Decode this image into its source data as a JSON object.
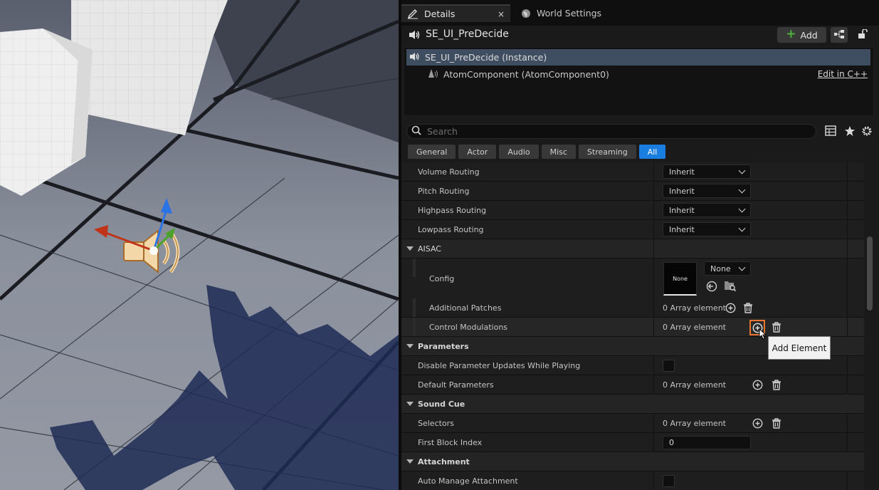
{
  "tabs": {
    "details": "Details",
    "world_settings": "World Settings",
    "close": "×"
  },
  "object": {
    "name": "SE_UI_PreDecide",
    "add_label": "Add"
  },
  "components": {
    "instance": "SE_UI_PreDecide (Instance)",
    "child": "AtomComponent (AtomComponent0)",
    "edit_link": "Edit in C++"
  },
  "search": {
    "placeholder": "Search"
  },
  "filters": [
    "General",
    "Actor",
    "Audio",
    "Misc",
    "Streaming",
    "All"
  ],
  "active_filter": "All",
  "properties": {
    "volume_routing": {
      "label": "Volume Routing",
      "value": "Inherit"
    },
    "pitch_routing": {
      "label": "Pitch Routing",
      "value": "Inherit"
    },
    "highpass_routing": {
      "label": "Highpass Routing",
      "value": "Inherit"
    },
    "lowpass_routing": {
      "label": "Lowpass Routing",
      "value": "Inherit"
    },
    "aisac": "AISAC",
    "config": {
      "label": "Config",
      "thumb": "None",
      "value": "None"
    },
    "additional_patches": {
      "label": "Additional Patches",
      "value": "0 Array element"
    },
    "control_modulations": {
      "label": "Control Modulations",
      "value": "0 Array element"
    },
    "parameters": "Parameters",
    "disable_param_updates": {
      "label": "Disable Parameter Updates While Playing",
      "checked": false
    },
    "default_parameters": {
      "label": "Default Parameters",
      "value": "0 Array element"
    },
    "sound_cue": "Sound Cue",
    "selectors": {
      "label": "Selectors",
      "value": "0 Array element"
    },
    "first_block_index": {
      "label": "First Block Index",
      "value": "0"
    },
    "attachment": "Attachment",
    "auto_manage_attachment": {
      "label": "Auto Manage Attachment",
      "checked": false
    }
  },
  "tooltip": "Add Element",
  "colors": {
    "selection": "#3f4d61",
    "accent_blue": "#1a7de0",
    "highlight_orange": "#e8742e",
    "add_green": "#4fb23d"
  },
  "icons": [
    "pencil-icon",
    "globe-icon",
    "speaker-icon",
    "plus-icon",
    "hierarchy-icon",
    "lock-icon",
    "atom-component-icon",
    "search-icon",
    "table-icon",
    "star-icon",
    "gear-icon",
    "chevron-down-icon",
    "add-element-icon",
    "trash-icon",
    "use-selected-icon",
    "browse-icon"
  ]
}
